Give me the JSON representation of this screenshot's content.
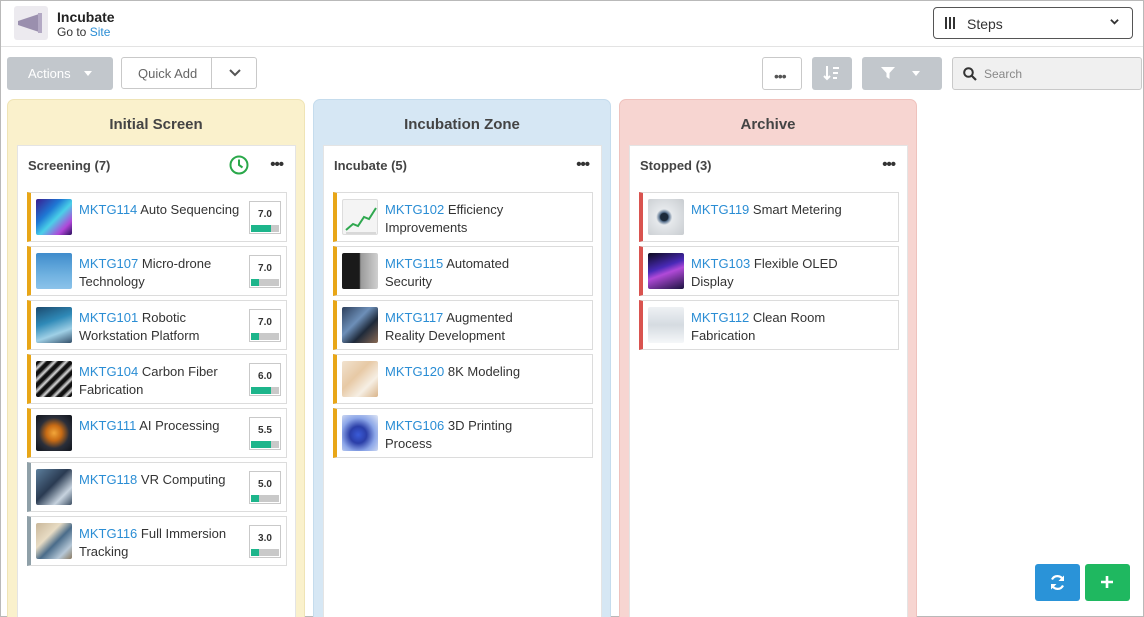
{
  "header": {
    "app_title": "Incubate",
    "goto_prefix": "Go to",
    "goto_link": "Site",
    "view_select": "Steps"
  },
  "toolbar": {
    "actions_label": "Actions",
    "quick_add_label": "Quick Add",
    "more_label": "•••",
    "search_placeholder": "Search"
  },
  "colors": {
    "link": "#2a8dd4",
    "score_fill": "#1db58b",
    "amber": "#e8a617",
    "grey": "#8fa0a8",
    "red": "#d9534f",
    "refresh_button": "#2a93d8",
    "add_button": "#1fb860"
  },
  "columns": [
    {
      "title": "Initial Screen",
      "lane_title": "Screening",
      "lane_count": "(7)",
      "cards": [
        {
          "id": "MKTG114",
          "title": "Auto Sequencing",
          "score": "7.0",
          "fill": 0.7
        },
        {
          "id": "MKTG107",
          "title": "Micro-drone Technology",
          "score": "7.0",
          "fill": 0.3
        },
        {
          "id": "MKTG101",
          "title": "Robotic Workstation Platform",
          "score": "7.0",
          "fill": 0.3
        },
        {
          "id": "MKTG104",
          "title": "Carbon Fiber Fabrication",
          "score": "6.0",
          "fill": 0.7
        },
        {
          "id": "MKTG111",
          "title": "AI Processing",
          "score": "5.5",
          "fill": 0.7
        },
        {
          "id": "MKTG118",
          "title": "VR Computing",
          "score": "5.0",
          "fill": 0.3
        },
        {
          "id": "MKTG116",
          "title": "Full Immersion Tracking",
          "score": "3.0",
          "fill": 0.3
        }
      ]
    },
    {
      "title": "Incubation Zone",
      "lane_title": "Incubate",
      "lane_count": "(5)",
      "cards": [
        {
          "id": "MKTG102",
          "title": "Efficiency Improvements"
        },
        {
          "id": "MKTG115",
          "title": "Automated Security"
        },
        {
          "id": "MKTG117",
          "title": "Augmented Reality Development"
        },
        {
          "id": "MKTG120",
          "title": "8K Modeling"
        },
        {
          "id": "MKTG106",
          "title": "3D Printing Process"
        }
      ]
    },
    {
      "title": "Archive",
      "lane_title": "Stopped",
      "lane_count": "(3)",
      "cards": [
        {
          "id": "MKTG119",
          "title": "Smart Metering"
        },
        {
          "id": "MKTG103",
          "title": "Flexible OLED Display"
        },
        {
          "id": "MKTG112",
          "title": "Clean Room Fabrication"
        }
      ]
    }
  ],
  "icons": {
    "logo": "megaphone-logo-icon",
    "view": "columns-icon",
    "sort": "sort-icon",
    "filter": "filter-icon",
    "search": "search-icon",
    "clock": "clock-icon",
    "refresh": "refresh-icon",
    "add": "plus-icon"
  }
}
